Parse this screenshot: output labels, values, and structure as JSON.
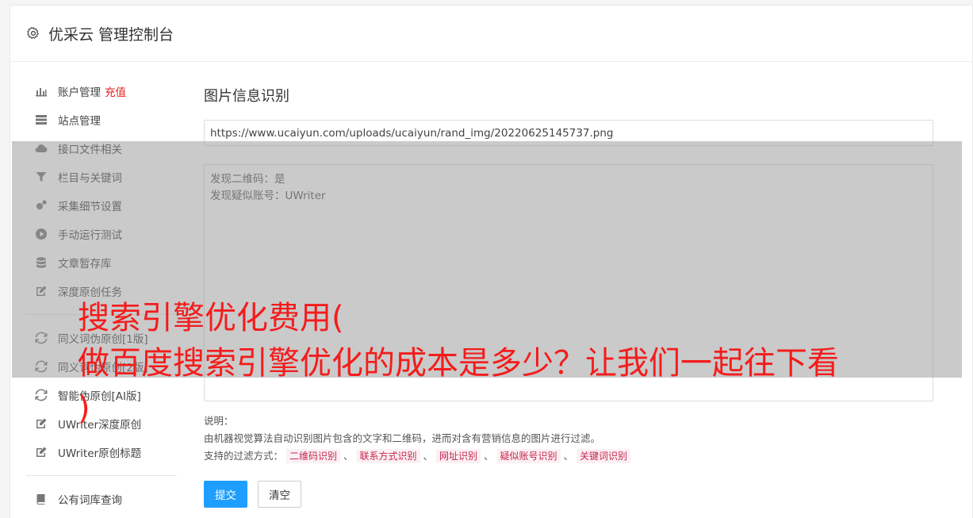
{
  "header": {
    "title": "优采云 管理控制台",
    "icon": "gear-icon"
  },
  "sidebar": {
    "items": [
      {
        "label": "账户管理",
        "badge": "充值",
        "icon": "bar-chart-icon"
      },
      {
        "label": "站点管理",
        "icon": "server-icon"
      },
      {
        "label": "接口文件相关",
        "icon": "cloud-upload-icon"
      },
      {
        "label": "栏目与关键词",
        "icon": "filter-icon"
      },
      {
        "label": "采集细节设置",
        "icon": "cogs-icon"
      },
      {
        "label": "手动运行测试",
        "icon": "play-circle-icon"
      },
      {
        "label": "文章暂存库",
        "icon": "database-icon"
      },
      {
        "label": "深度原创任务",
        "icon": "edit-icon"
      },
      {
        "label": "同义词伪原创[1版]",
        "icon": "refresh-icon"
      },
      {
        "label": "同义词伪原创[2版]",
        "icon": "refresh-icon"
      },
      {
        "label": "智能伪原创[AI版]",
        "icon": "refresh-icon"
      },
      {
        "label": "UWriter深度原创",
        "icon": "edit-icon"
      },
      {
        "label": "UWriter原创标题",
        "icon": "edit-icon"
      },
      {
        "label": "公有词库查询",
        "icon": "book-icon"
      }
    ]
  },
  "main": {
    "title": "图片信息识别",
    "url_value": "https://www.ucaiyun.com/uploads/ucaiyun/rand_img/20220625145737.png",
    "result_lines": [
      "发现二维码：是",
      "发现疑似账号：UWriter"
    ],
    "desc_label": "说明：",
    "desc_text": "由机器视觉算法自动识别图片包含的文字和二维码，进而对含有营销信息的图片进行过滤。",
    "filter_label": "支持的过滤方式：",
    "filter_tags": [
      "二维码识别",
      "联系方式识别",
      "网址识别",
      "疑似账号识别",
      "关键词识别"
    ],
    "separator": "、",
    "submit_label": "提交",
    "clear_label": "清空"
  },
  "overlay": {
    "line1": "搜索引擎优化费用(",
    "line2": "做百度搜索引擎优化的成本是多少？让我们一起往下看",
    "line3": ")"
  },
  "colors": {
    "primary": "#1e9fff",
    "overlay_text": "#f41c1c",
    "badge": "#e02020",
    "tag_text": "#c7254e"
  }
}
